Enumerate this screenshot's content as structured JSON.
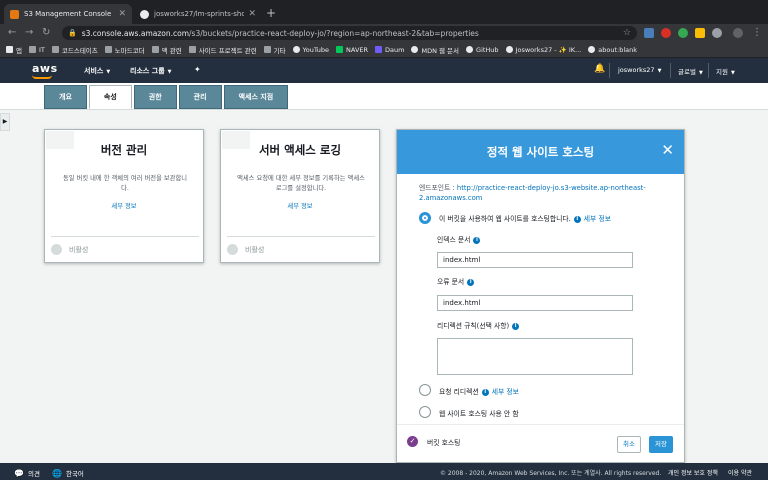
{
  "browser": {
    "tabs": [
      {
        "title": "S3 Management Console",
        "favicon_color": "#e47911"
      },
      {
        "title": "josworks27/lm-sprints-shortly-..."
      }
    ],
    "address": {
      "host": "s3.console.aws.amazon.com",
      "path": "/s3/buckets/practice-react-deploy-jo/?region=ap-northeast-2&tab=properties"
    },
    "bookmarks": [
      "앱",
      "IT",
      "코드스테이츠",
      "노마드코더",
      "액 관련",
      "사이드 프로젝트 관련",
      "기타",
      "YouTube",
      "NAVER",
      "Daum",
      "MDN 웹 문서",
      "GitHub",
      "Josworks27 - ✨ IK...",
      "about:blank"
    ]
  },
  "aws_nav": {
    "logo": "aws",
    "services": "서비스",
    "resource_groups": "리소스 그룹",
    "account": "josworks27",
    "region": "글로벌",
    "support": "지원"
  },
  "tabs": [
    "개요",
    "속성",
    "권한",
    "관리",
    "액세스 지점"
  ],
  "cards": [
    {
      "title": "버전 관리",
      "description": "동일 버킷 내에 한 객체의 여러 버전을 보관합니다.",
      "link": "세부 정보",
      "status": "비활성"
    },
    {
      "title": "서버 액세스 로깅",
      "description": "액세스 요청에 대한 세부 정보를 기록하는 액세스 로그를 설정합니다.",
      "link": "세부 정보",
      "status": "비활성"
    }
  ],
  "hosting": {
    "title": "정적 웹 사이트 호스팅",
    "endpoint_label": "엔드포인트 : ",
    "endpoint_url": "http://practice-react-deploy-jo.s3-website.ap-northeast-2.amazonaws.com",
    "option_host": "이 버킷을 사용하여 웹 사이트를 호스팅합니다.",
    "info_link": "세부 정보",
    "index_label": "인덱스 문서",
    "index_value": "index.html",
    "error_label": "오류 문서",
    "error_value": "index.html",
    "redirect_rules_label": "리디렉션 규칙(선택 사항)",
    "option_redirect": "요청 리디렉션",
    "option_redirect_link": "세부 정보",
    "option_disable": "웹 사이트 호스팅 사용 안 함",
    "bucket_hosting": "버킷 호스팅",
    "cancel": "취소",
    "save": "저장"
  },
  "footer": {
    "feedback": "의견",
    "language": "한국어",
    "copyright": "© 2008 - 2020, Amazon Web Services, Inc. 또는 계열사. All rights reserved.",
    "privacy": "개인 정보 보호 정책",
    "terms": "이용 약관"
  }
}
